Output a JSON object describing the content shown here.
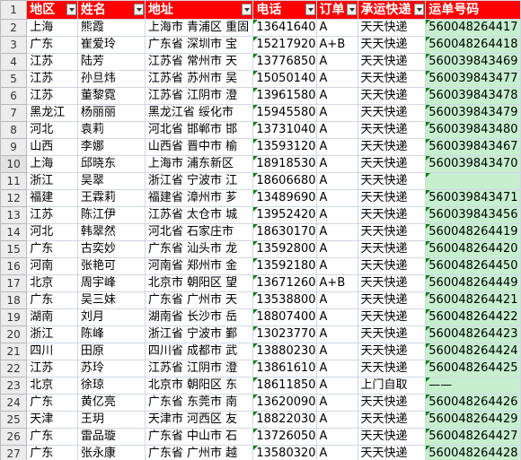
{
  "headers": [
    "地区",
    "姓名",
    "地址",
    "电话",
    "订单",
    "承运快递",
    "运单号码"
  ],
  "rows": [
    [
      "上海",
      "熊霞",
      "上海市 青浦区 重固",
      "13641640",
      "A",
      "天天快递",
      "560048264417"
    ],
    [
      "广东",
      "崔爱玲",
      "广东省 深圳市 宝",
      "15217920",
      "A+B",
      "天天快递",
      "560048264418"
    ],
    [
      "江苏",
      "陆芳",
      "江苏省 常州市 天",
      "13776850",
      "A",
      "天天快递",
      "560039843469"
    ],
    [
      "江苏",
      "孙旦炜",
      "江苏省 苏州市 吴",
      "15050140",
      "A",
      "天天快递",
      "560039843477"
    ],
    [
      "江苏",
      "董黎霓",
      "江苏省 江阴市 澄",
      "13961580",
      "A",
      "天天快递",
      "560039843478"
    ],
    [
      "黑龙江",
      "杨丽丽",
      "黑龙江省 绥化市",
      "15945580",
      "A",
      "天天快递",
      "560039843479"
    ],
    [
      "河北",
      "袁莉",
      "河北省 邯郸市 邯",
      "13731040",
      "A",
      "天天快递",
      "560039843480"
    ],
    [
      "山西",
      "李娜",
      "山西省 晋中市 榆",
      "13593120",
      "A",
      "天天快递",
      "560039843467"
    ],
    [
      "上海",
      "邱晓东",
      "上海市 浦东新区",
      "18918530",
      "A",
      "天天快递",
      "560039843470"
    ],
    [
      "浙江",
      "吴翠",
      "浙江省 宁波市 江",
      "18606680",
      "A",
      "天天快递",
      ""
    ],
    [
      "福建",
      "王霖莉",
      "福建省 漳州市 芗",
      "13489690",
      "A",
      "天天快递",
      "560039843471"
    ],
    [
      "江苏",
      "陈江伊",
      "江苏省 太仓市 城",
      "13952420",
      "A",
      "天天快递",
      "560039843456"
    ],
    [
      "河北",
      "韩翠然",
      "河北省 石家庄市",
      "18630170",
      "A",
      "天天快递",
      "560048264419"
    ],
    [
      "广东",
      "古奕妙",
      "广东省 汕头市 龙",
      "13592800",
      "A",
      "天天快递",
      "560048264420"
    ],
    [
      "河南",
      "张艳可",
      "河南省 郑州市 金",
      "13592180",
      "A",
      "天天快递",
      "560048264450"
    ],
    [
      "北京",
      "周宇峰",
      "北京市 朝阳区 望",
      "13671260",
      "A+B",
      "天天快递",
      "560048264449"
    ],
    [
      "广东",
      "吴三妹",
      "广东省 广州市 天",
      "13538800",
      "A",
      "天天快递",
      "560048264421"
    ],
    [
      "湖南",
      "刘月",
      "湖南省 长沙市 岳",
      "18807400",
      "A",
      "天天快递",
      "560048264422"
    ],
    [
      "浙江",
      "陈峰",
      "浙江省 宁波市 鄞",
      "13023770",
      "A",
      "天天快递",
      "560048264423"
    ],
    [
      "四川",
      "田原",
      "四川省 成都市 武",
      "13880230",
      "A",
      "天天快递",
      "560048264424"
    ],
    [
      "江苏",
      "苏玲",
      "江苏省 江阴市 澄",
      "13861610",
      "A",
      "天天快递",
      "560048264425"
    ],
    [
      "北京",
      "徐琼",
      "北京市 朝阳区 东",
      "18611850",
      "A",
      "上门自取",
      "——"
    ],
    [
      "广东",
      "黄亿亮",
      "广东省 东莞市 南",
      "13620090",
      "A",
      "天天快递",
      "560048264426"
    ],
    [
      "天津",
      "王玥",
      "天津市 河西区 友",
      "18822030",
      "A",
      "天天快递",
      "560048264429"
    ],
    [
      "广东",
      "雷品璇",
      "广东省 中山市 石",
      "13726050",
      "A",
      "天天快递",
      "560048264427"
    ],
    [
      "广东",
      "张永康",
      "广东省 广州市 越",
      "13580320",
      "A",
      "天天快递",
      "560048264428"
    ]
  ]
}
